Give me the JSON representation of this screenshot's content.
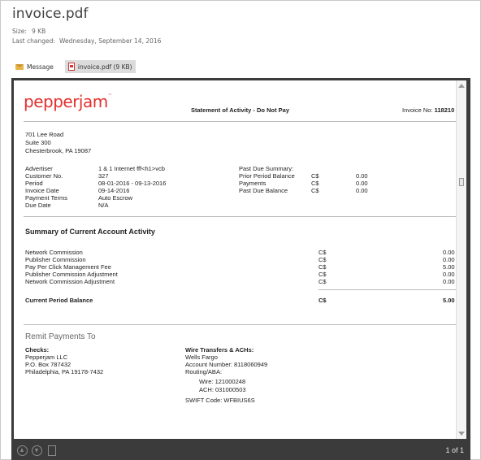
{
  "file": {
    "title": "invoice.pdf",
    "size_label": "Size:",
    "size_value": "9 KB",
    "changed_label": "Last changed:",
    "changed_value": "Wednesday, September 14, 2016"
  },
  "attachments": [
    {
      "label": "Message",
      "icon": "envelope-icon",
      "selected": false
    },
    {
      "label": "invoice.pdf (9 KB)",
      "icon": "pdf-file-icon",
      "selected": true
    }
  ],
  "viewer": {
    "page_count": "1 of 1"
  },
  "invoice": {
    "logo": "pepperjam",
    "logo_mark": "™",
    "header_title": "Statement of Activity - Do Not Pay",
    "invoice_no_label": "Invoice No:",
    "invoice_no": "118210",
    "address": [
      "701 Lee Road",
      "Suite 300",
      "Chesterbrook, PA 19087"
    ],
    "details": [
      {
        "label": "Advertiser",
        "value": "1 & 1 Internet fff<h1>vcb"
      },
      {
        "label": "Customer No.",
        "value": "327"
      },
      {
        "label": "Period",
        "value": "08-01-2016 - 09-13-2016"
      },
      {
        "label": "Invoice Date",
        "value": "09-14-2016"
      },
      {
        "label": "Payment Terms",
        "value": "Auto Escrow"
      },
      {
        "label": "Due Date",
        "value": "N/A"
      }
    ],
    "past_due": {
      "title": "Past Due Summary:",
      "rows": [
        {
          "label": "Prior Period Balance",
          "currency": "C$",
          "value": "0.00"
        },
        {
          "label": "Payments",
          "currency": "C$",
          "value": "0.00"
        },
        {
          "label": "Past Due Balance",
          "currency": "C$",
          "value": "0.00"
        }
      ]
    },
    "summary_title": "Summary of Current Account Activity",
    "summary_rows": [
      {
        "label": "Network Commission",
        "currency": "C$",
        "value": "0.00"
      },
      {
        "label": "Publisher Commission",
        "currency": "C$",
        "value": "0.00"
      },
      {
        "label": "Pay Per Click Management Fee",
        "currency": "C$",
        "value": "5.00"
      },
      {
        "label": "Publisher Commission Adjustment",
        "currency": "C$",
        "value": "0.00"
      },
      {
        "label": "Network Commission Adjustment",
        "currency": "C$",
        "value": "0.00"
      }
    ],
    "current_balance": {
      "label": "Current Period Balance",
      "currency": "C$",
      "value": "5.00"
    },
    "remit_title": "Remit Payments To",
    "checks": {
      "title": "Checks:",
      "lines": [
        "Pepperjam LLC",
        "P.O. Box 787432",
        "Philadelphia, PA 19178-7432"
      ]
    },
    "wire": {
      "title": "Wire Transfers & ACHs:",
      "bank": "Wells Fargo",
      "account": "Account Number: 8118060949",
      "routing_label": "Routing/ABA:",
      "wire": "Wire: 121000248",
      "ach": "ACH: 031000503",
      "swift": "SWIFT Code: WFBIUS6S"
    }
  }
}
